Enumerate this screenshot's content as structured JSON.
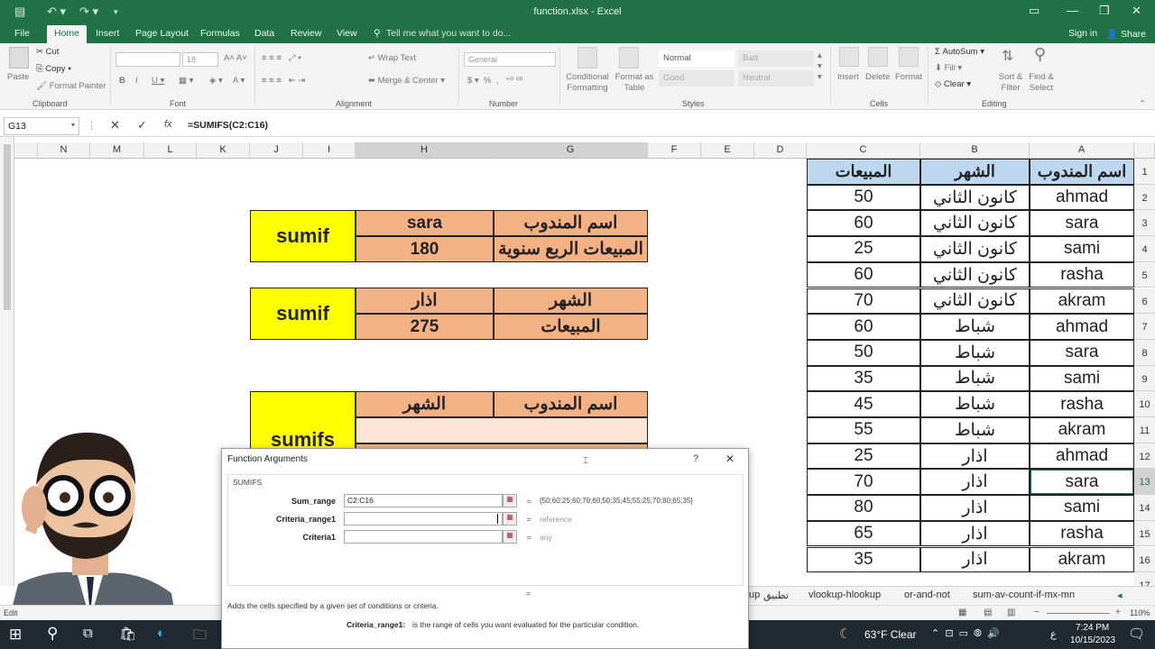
{
  "window": {
    "title": "function.xlsx - Excel",
    "signin": "Sign in",
    "share": "Share"
  },
  "ribbon_tabs": [
    "File",
    "Home",
    "Insert",
    "Page Layout",
    "Formulas",
    "Data",
    "Review",
    "View"
  ],
  "tell_me": "Tell me what you want to do...",
  "ribbon": {
    "paste": "Paste",
    "cut": "Cut",
    "copy": "Copy",
    "format_painter": "Format Painter",
    "font_size": "18",
    "wrap_text": "Wrap Text",
    "merge_center": "Merge & Center",
    "number_format": "General",
    "conditional_formatting": "Conditional Formatting",
    "format_as_table": "Format as Table",
    "styles": {
      "normal": "Normal",
      "bad": "Bad",
      "good": "Good",
      "neutral": "Neutral"
    },
    "insert": "Insert",
    "delete": "Delete",
    "format": "Format",
    "autosum": "AutoSum",
    "fill": "Fill",
    "clear": "Clear",
    "sort_filter": "Sort & Filter",
    "find_select": "Find & Select",
    "groups": {
      "clipboard": "Clipboard",
      "font": "Font",
      "alignment": "Alignment",
      "number": "Number",
      "styles": "Styles",
      "cells": "Cells",
      "editing": "Editing"
    }
  },
  "formula_bar": {
    "name_box": "G13",
    "fx": "fx",
    "formula": "=SUMIFS(C2:C16)"
  },
  "columns": [
    "A",
    "B",
    "C",
    "D",
    "E",
    "F",
    "G",
    "H",
    "I",
    "J",
    "K",
    "L",
    "M",
    "N"
  ],
  "rows": [
    "1",
    "2",
    "3",
    "4",
    "5",
    "6",
    "7",
    "8",
    "9",
    "10",
    "11",
    "12",
    "13",
    "14",
    "15",
    "16",
    "17"
  ],
  "table": {
    "headers": [
      "اسم المندوب",
      "الشهر",
      "المبيعات"
    ],
    "data": [
      [
        "ahmad",
        "كانون الثاني",
        "50"
      ],
      [
        "sara",
        "كانون الثاني",
        "60"
      ],
      [
        "sami",
        "كانون الثاني",
        "25"
      ],
      [
        "rasha",
        "كانون الثاني",
        "60"
      ],
      [
        "akram",
        "كانون الثاني",
        "70"
      ],
      [
        "ahmad",
        "شباط",
        "60"
      ],
      [
        "sara",
        "شباط",
        "50"
      ],
      [
        "sami",
        "شباط",
        "35"
      ],
      [
        "rasha",
        "شباط",
        "45"
      ],
      [
        "akram",
        "شباط",
        "55"
      ],
      [
        "ahmad",
        "اذار",
        "25"
      ],
      [
        "sara",
        "اذار",
        "70"
      ],
      [
        "sami",
        "اذار",
        "80"
      ],
      [
        "rasha",
        "اذار",
        "65"
      ],
      [
        "akram",
        "اذار",
        "35"
      ]
    ]
  },
  "blocks": {
    "b1": {
      "label": "sumif",
      "r1g": "اسم المندوب",
      "r1h": "sara",
      "r2g": "المبيعات الربع سنوية",
      "r2h": "180"
    },
    "b2": {
      "label": "sumif",
      "r1g": "الشهر",
      "r1h": "اذار",
      "r2g": "المبيعات",
      "r2h": "275"
    },
    "b3": {
      "label": "sumifs",
      "r1g": "اسم المندوب",
      "r1h": "الشهر"
    }
  },
  "sheet_tabs": [
    "تطبيق",
    "vlookup-hlookup",
    "or-and-not",
    "sum-av-count-if-mx-mn"
  ],
  "sheet_tab_partial": "up",
  "status": {
    "mode": "Edit",
    "zoom": "110%"
  },
  "dialog": {
    "title": "Function Arguments",
    "help": "?",
    "close": "✕",
    "func": "SUMIFS",
    "args": [
      {
        "label": "Sum_range",
        "value": "C2:C16",
        "result": "{50;60;25;60;70;60;50;35;45;55;25;70;80;65;35}"
      },
      {
        "label": "Criteria_range1",
        "value": "",
        "result": "reference"
      },
      {
        "label": "Criteria1",
        "value": "",
        "result": "any"
      }
    ],
    "equals": "=",
    "description": "Adds the cells specified by a given set of conditions or criteria.",
    "arg_name": "Criteria_range1:",
    "arg_desc": "is the range of cells you want evaluated for the particular condition."
  },
  "taskbar": {
    "weather": "63°F  Clear",
    "time": "7:24 PM",
    "date": "10/15/2023",
    "lang": "ع"
  }
}
